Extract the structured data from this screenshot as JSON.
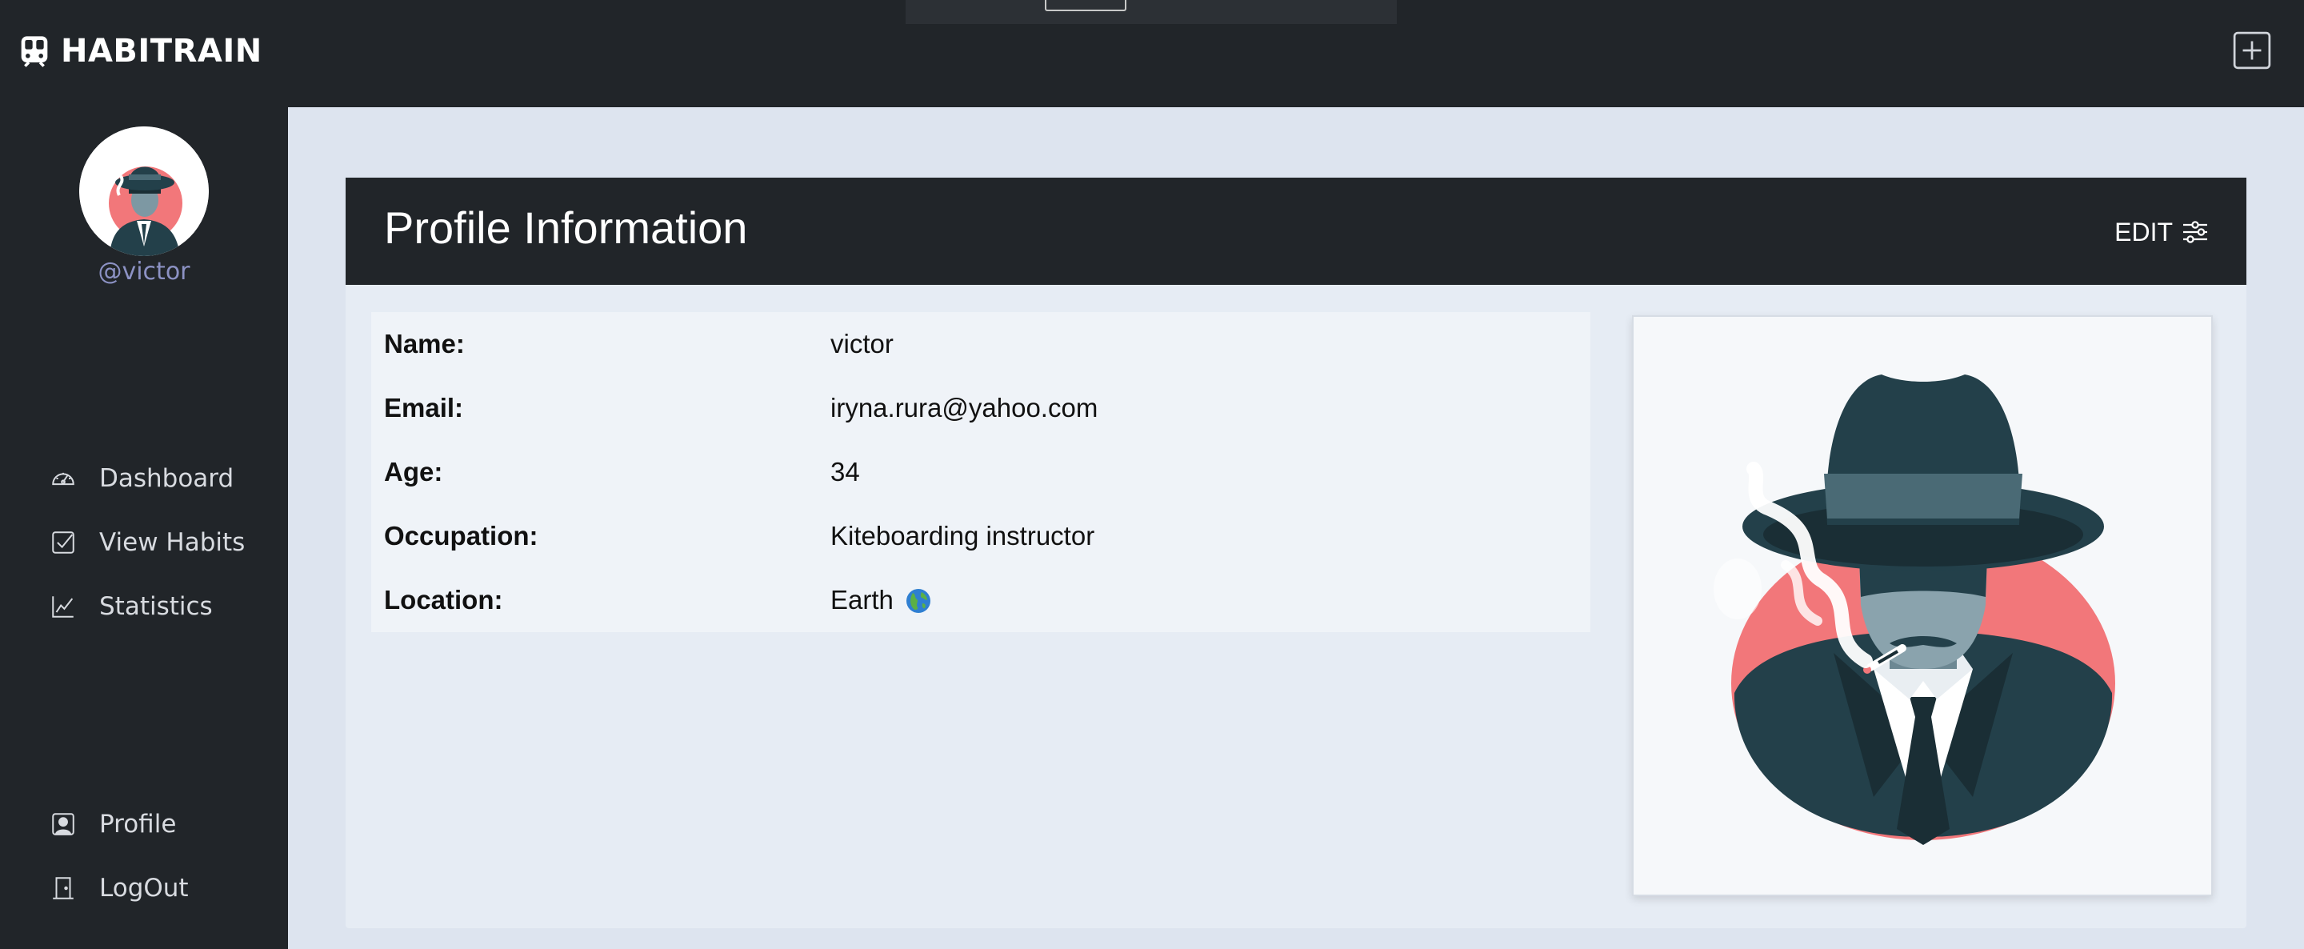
{
  "app": {
    "brand": "HABITRAIN",
    "brand_icon": "train-icon",
    "add_icon": "plus-square-icon"
  },
  "sidebar": {
    "username": "@victor",
    "items": [
      {
        "label": "Dashboard",
        "icon": "speedometer-icon"
      },
      {
        "label": "View Habits",
        "icon": "check-square-icon"
      },
      {
        "label": "Statistics",
        "icon": "graph-up-icon"
      },
      {
        "label": "Profile",
        "icon": "person-square-icon"
      },
      {
        "label": "LogOut",
        "icon": "door-icon"
      }
    ]
  },
  "profile": {
    "title": "Profile Information",
    "edit_label": "EDIT",
    "fields": [
      {
        "label": "Name:",
        "value": "victor"
      },
      {
        "label": "Email:",
        "value": "iryna.rura@yahoo.com"
      },
      {
        "label": "Age:",
        "value": "34"
      },
      {
        "label": "Occupation:",
        "value": "Kiteboarding instructor"
      },
      {
        "label": "Location:",
        "value": "Earth"
      }
    ]
  },
  "colors": {
    "navbar": "#212529",
    "background": "#dde4ef",
    "username": "#8c92c4",
    "accent_red": "#f2777a",
    "figure_dark": "#23404a"
  }
}
